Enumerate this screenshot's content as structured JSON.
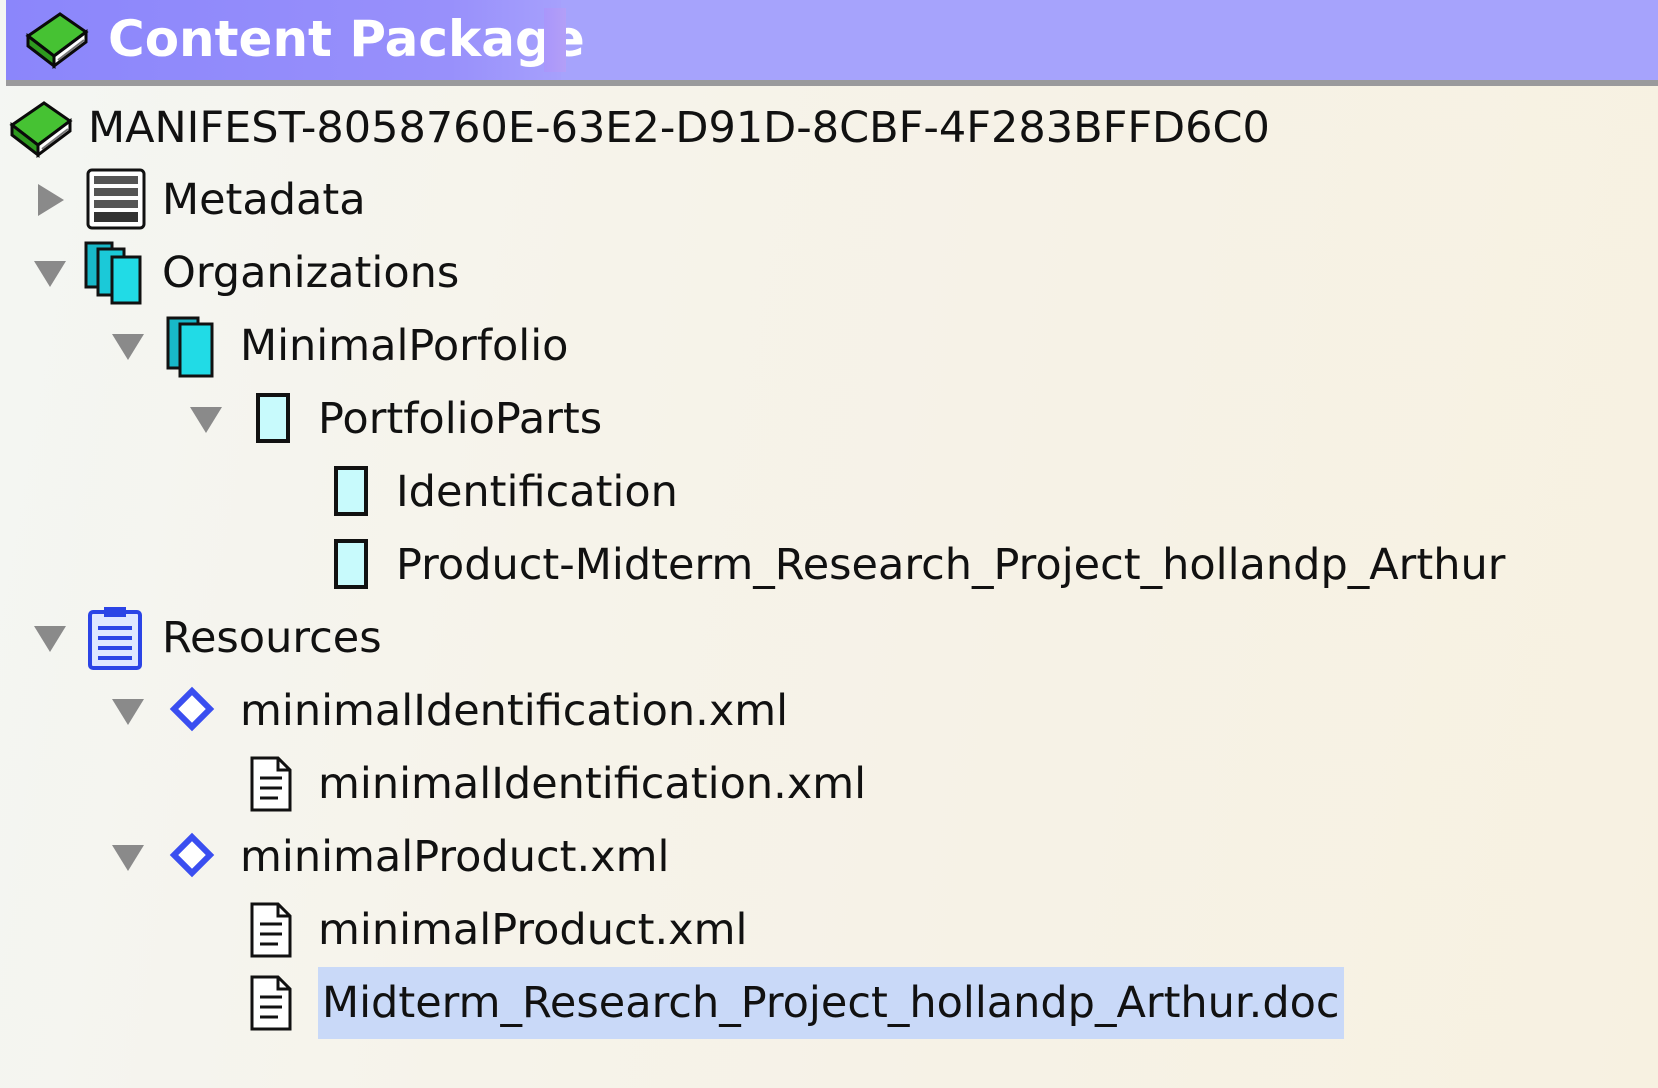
{
  "window": {
    "title": "Content Package",
    "title_icon": "green-book-icon"
  },
  "tree": {
    "root": {
      "label": "MANIFEST-8058760E-63E2-D91D-8CBF-4F283BFFD6C0",
      "icon": "green-book-icon"
    },
    "metadata": {
      "label": "Metadata",
      "icon": "metadata-stack-icon",
      "expanded": false
    },
    "organizations": {
      "label": "Organizations",
      "icon": "organizations-icon",
      "expanded": true
    },
    "minimal_portfolio": {
      "label": "MinimalPorfolio",
      "icon": "organization-icon",
      "expanded": true
    },
    "portfolio_parts": {
      "label": "PortfolioParts",
      "icon": "item-icon",
      "expanded": true
    },
    "identification": {
      "label": "Identification",
      "icon": "item-icon"
    },
    "product_item": {
      "label": "Product-Midterm_Research_Project_hollandp_Arthur",
      "icon": "item-icon"
    },
    "resources": {
      "label": "Resources",
      "icon": "resources-icon",
      "expanded": true
    },
    "res_identification": {
      "label": "minimalIdentification.xml",
      "icon": "resource-diamond-icon",
      "expanded": true
    },
    "file_identification": {
      "label": "minimalIdentification.xml",
      "icon": "file-icon"
    },
    "res_product": {
      "label": "minimalProduct.xml",
      "icon": "resource-diamond-icon",
      "expanded": true
    },
    "file_product": {
      "label": "minimalProduct.xml",
      "icon": "file-icon"
    },
    "file_doc": {
      "label": "Midterm_Research_Project_hollandp_Arthur.doc",
      "icon": "file-icon",
      "selected": true
    }
  },
  "colors": {
    "title_bar": "#a6a3fc",
    "selection": "#c9d9f8",
    "book_green": "#3dbb2c",
    "cyan": "#1fd6e0",
    "resource_blue": "#3e58f0"
  }
}
